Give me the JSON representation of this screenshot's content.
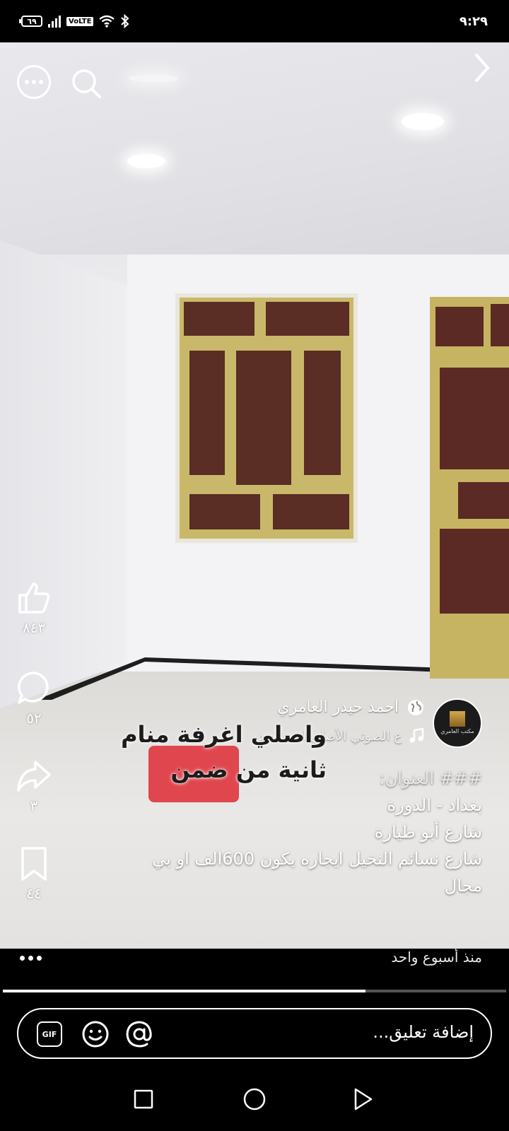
{
  "status_bar": {
    "battery": "٦٩",
    "volte": "VoLTE",
    "time": "٩:٢٩"
  },
  "icons": {
    "more": "more-icon",
    "search": "search-icon",
    "next": "chevron-right-icon",
    "like": "thumbs-up-icon",
    "comment": "comment-icon",
    "share": "share-icon",
    "save": "bookmark-icon",
    "globe": "globe-icon",
    "music": "music-note-icon",
    "gif": "gif-icon",
    "emoji": "emoji-icon",
    "mention": "at-icon",
    "nav_recents": "square-icon",
    "nav_home": "circle-icon",
    "nav_back": "triangle-back-icon"
  },
  "actions": {
    "likes": "٨٤٣",
    "comments": "٥٢",
    "shares": "٣",
    "saves": "٤٤"
  },
  "post": {
    "author": "احمد حيدر العامري",
    "audio": "ع الصوتي الأصلي احمد حيد",
    "avatar_text": "مكتب العامري",
    "video_caption_line1": "واصلي اغرفة منام",
    "video_caption_line2": "ثانية من ضمن",
    "description": {
      "line1": "###  العنوان:",
      "line2": "بغداد - الدورة",
      "line3": "شارع أبو طيارة",
      "line4": "شارع نسائم النخيل ايجاره يكون 600الف او بي",
      "line5": "مجال"
    },
    "time_ago": "منذ أسبوع واحد",
    "progress": 0.72
  },
  "comment_bar": {
    "placeholder": "إضافة تعليق...",
    "gif_label": "GIF"
  },
  "colors": {
    "caption_highlight": "#e0464e",
    "window_frame": "#c9b86a",
    "background": "#000000"
  }
}
